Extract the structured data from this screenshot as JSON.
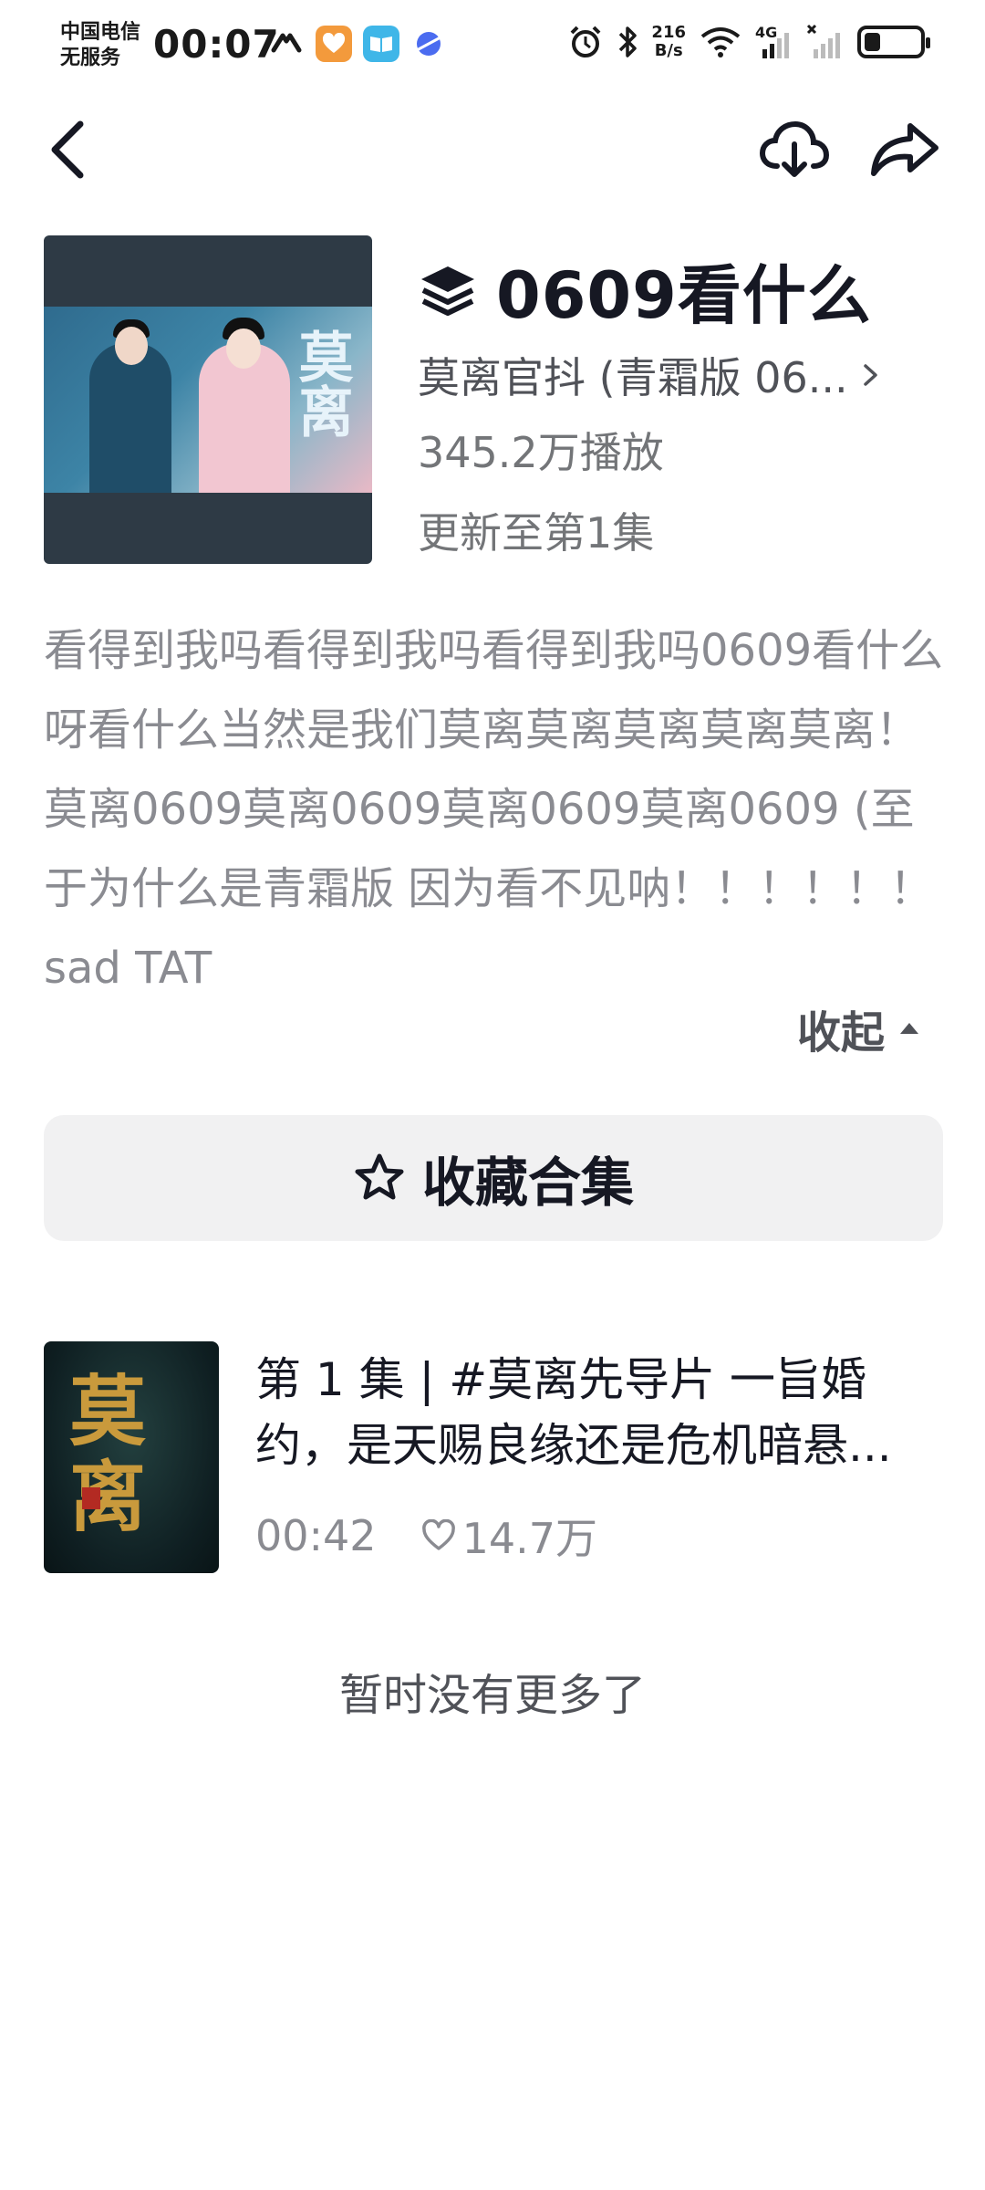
{
  "status_bar": {
    "carrier_line1": "中国电信",
    "carrier_line2": "无服务",
    "time": "00:07",
    "net_speed_value": "216",
    "net_speed_unit": "B/s",
    "signal_label": "4G",
    "battery_level": 0.3
  },
  "nav": {
    "back_icon": "chevron-left-icon",
    "download_icon": "cloud-download-icon",
    "share_icon": "share-arrow-icon"
  },
  "collection": {
    "title": "0609看什么",
    "title_icon": "layers-icon",
    "source": "莫离官抖 (青霜版 06...",
    "plays": "345.2万播放",
    "update_status": "更新至第1集",
    "cover_text": "莫离",
    "description": "看得到我吗看得到我吗看得到我吗0609看什么呀看什么当然是我们莫离莫离莫离莫离莫离！莫离0609莫离0609莫离0609莫离0609 (至于为什么是青霜版 因为看不见呐！！！！！！ sad TAT",
    "collapse_label": "收起",
    "collect_button_label": "收藏合集"
  },
  "episodes": [
    {
      "title": "第 1 集 | #莫离先导片 一旨婚约，是天赐良缘还是危机暗悬...",
      "duration": "00:42",
      "likes": "14.7万",
      "thumb_text": "莫离"
    }
  ],
  "footer": {
    "no_more_label": "暂时没有更多了"
  },
  "colors": {
    "text_primary": "#161823",
    "text_secondary": "#737578",
    "text_tertiary": "#8a8b91",
    "button_bg": "#f1f1f2",
    "thumb_gold": "#c99a3c"
  }
}
